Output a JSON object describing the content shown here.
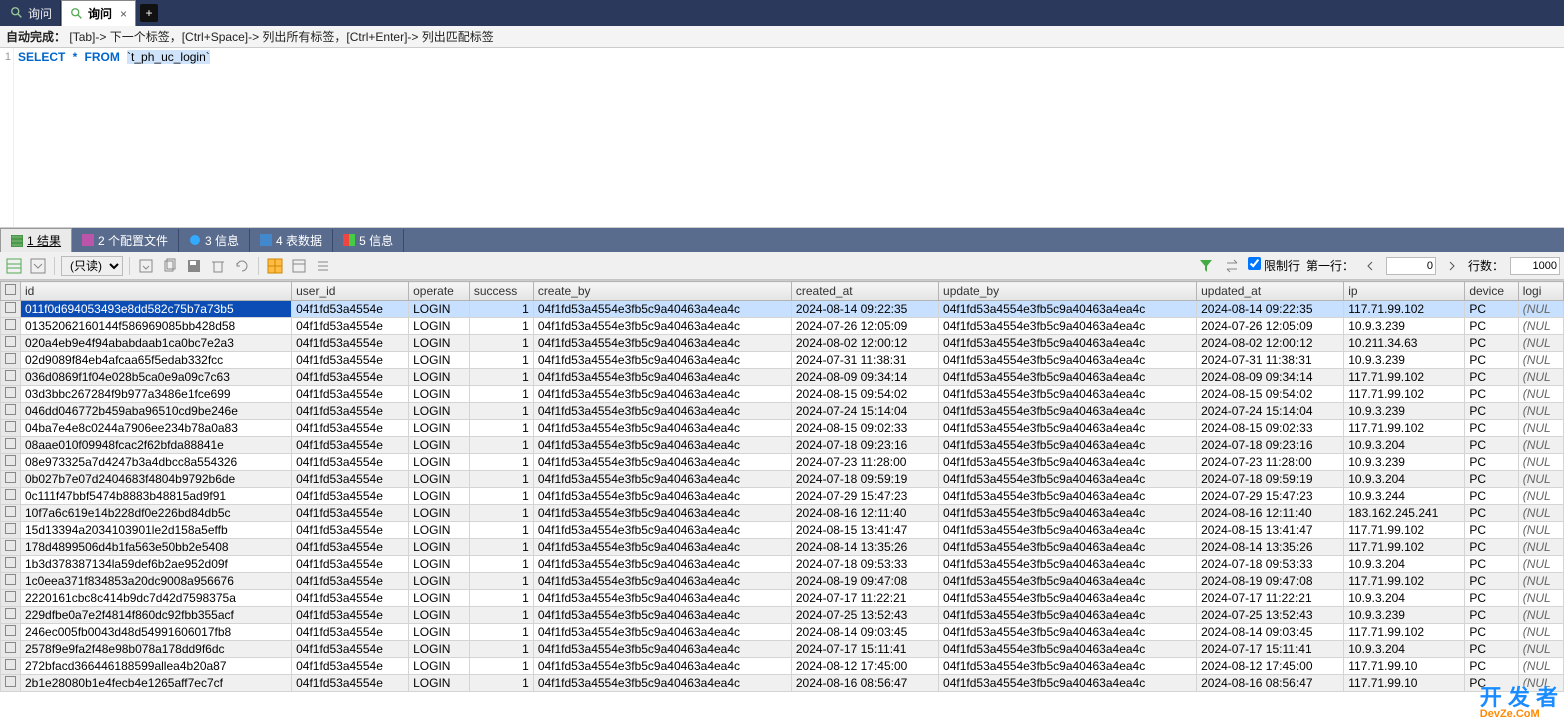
{
  "tabs": {
    "inactive": "询问",
    "active": "询问"
  },
  "hint": {
    "label": "自动完成：",
    "text": "[Tab]-> 下一个标签，[Ctrl+Space]-> 列出所有标签，[Ctrl+Enter]-> 列出匹配标签"
  },
  "editor": {
    "line": "1",
    "kw_select": "SELECT",
    "kw_star": "*",
    "kw_from": "FROM",
    "table": "`t_ph_uc_login`"
  },
  "result_tabs": {
    "t1": "1 结果",
    "t2": "2 个配置文件",
    "t3": "3 信息",
    "t4": "4 表数据",
    "t5": "5 信息"
  },
  "toolbar": {
    "readonly": "(只读)",
    "limit_label": "限制行",
    "firstrow_label": "第一行：",
    "firstrow_value": "0",
    "rows_label": "行数：",
    "rows_value": "1000"
  },
  "columns": [
    "id",
    "user_id",
    "operate",
    "success",
    "create_by",
    "created_at",
    "update_by",
    "updated_at",
    "ip",
    "device",
    "logi"
  ],
  "rows": [
    {
      "id": "011f0d694053493e8dd582c75b7a73b5",
      "created_at": "2024-08-14 09:22:35",
      "updated_at": "2024-08-14 09:22:35",
      "ip": "117.71.99.102"
    },
    {
      "id": "01352062160144f586969085bb428d58",
      "created_at": "2024-07-26 12:05:09",
      "updated_at": "2024-07-26 12:05:09",
      "ip": "10.9.3.239"
    },
    {
      "id": "020a4eb9e4f94ababdaab1ca0bc7e2a3",
      "created_at": "2024-08-02 12:00:12",
      "updated_at": "2024-08-02 12:00:12",
      "ip": "10.211.34.63"
    },
    {
      "id": "02d9089f84eb4afcaa65f5edab332fcc",
      "created_at": "2024-07-31 11:38:31",
      "updated_at": "2024-07-31 11:38:31",
      "ip": "10.9.3.239"
    },
    {
      "id": "036d0869f1f04e028b5ca0e9a09c7c63",
      "created_at": "2024-08-09 09:34:14",
      "updated_at": "2024-08-09 09:34:14",
      "ip": "117.71.99.102"
    },
    {
      "id": "03d3bbc267284f9b977a3486e1fce699",
      "created_at": "2024-08-15 09:54:02",
      "updated_at": "2024-08-15 09:54:02",
      "ip": "117.71.99.102"
    },
    {
      "id": "046dd046772b459aba96510cd9be246e",
      "created_at": "2024-07-24 15:14:04",
      "updated_at": "2024-07-24 15:14:04",
      "ip": "10.9.3.239"
    },
    {
      "id": "04ba7e4e8c0244a7906ee234b78a0a83",
      "created_at": "2024-08-15 09:02:33",
      "updated_at": "2024-08-15 09:02:33",
      "ip": "117.71.99.102"
    },
    {
      "id": "08aae010f09948fcac2f62bfda88841e",
      "created_at": "2024-07-18 09:23:16",
      "updated_at": "2024-07-18 09:23:16",
      "ip": "10.9.3.204"
    },
    {
      "id": "08e973325a7d4247b3a4dbcc8a554326",
      "created_at": "2024-07-23 11:28:00",
      "updated_at": "2024-07-23 11:28:00",
      "ip": "10.9.3.239"
    },
    {
      "id": "0b027b7e07d2404683f4804b9792b6de",
      "created_at": "2024-07-18 09:59:19",
      "updated_at": "2024-07-18 09:59:19",
      "ip": "10.9.3.204"
    },
    {
      "id": "0c111f47bbf5474b8883b48815ad9f91",
      "created_at": "2024-07-29 15:47:23",
      "updated_at": "2024-07-29 15:47:23",
      "ip": "10.9.3.244"
    },
    {
      "id": "10f7a6c619e14b228df0e226bd84db5c",
      "created_at": "2024-08-16 12:11:40",
      "updated_at": "2024-08-16 12:11:40",
      "ip": "183.162.245.241"
    },
    {
      "id": "15d13394a2034103901le2d158a5effb",
      "created_at": "2024-08-15 13:41:47",
      "updated_at": "2024-08-15 13:41:47",
      "ip": "117.71.99.102"
    },
    {
      "id": "178d4899506d4b1fa563e50bb2e5408",
      "created_at": "2024-08-14 13:35:26",
      "updated_at": "2024-08-14 13:35:26",
      "ip": "117.71.99.102"
    },
    {
      "id": "1b3d378387134la59def6b2ae952d09f",
      "created_at": "2024-07-18 09:53:33",
      "updated_at": "2024-07-18 09:53:33",
      "ip": "10.9.3.204"
    },
    {
      "id": "1c0eea371f834853a20dc9008a956676",
      "created_at": "2024-08-19 09:47:08",
      "updated_at": "2024-08-19 09:47:08",
      "ip": "117.71.99.102"
    },
    {
      "id": "2220161cbc8c414b9dc7d42d7598375a",
      "created_at": "2024-07-17 11:22:21",
      "updated_at": "2024-07-17 11:22:21",
      "ip": "10.9.3.204"
    },
    {
      "id": "229dfbe0a7e2f4814f860dc92fbb355acf",
      "created_at": "2024-07-25 13:52:43",
      "updated_at": "2024-07-25 13:52:43",
      "ip": "10.9.3.239"
    },
    {
      "id": "246ec005fb0043d48d54991606017fb8",
      "created_at": "2024-08-14 09:03:45",
      "updated_at": "2024-08-14 09:03:45",
      "ip": "117.71.99.102"
    },
    {
      "id": "2578f9e9fa2f48e98b078a178dd9f6dc",
      "created_at": "2024-07-17 15:11:41",
      "updated_at": "2024-07-17 15:11:41",
      "ip": "10.9.3.204"
    },
    {
      "id": "272bfacd366446188599allea4b20a87",
      "created_at": "2024-08-12 17:45:00",
      "updated_at": "2024-08-12 17:45:00",
      "ip": "117.71.99.10"
    },
    {
      "id": "2b1e28080b1e4fecb4e1265aff7ec7cf",
      "created_at": "2024-08-16 08:56:47",
      "updated_at": "2024-08-16 08:56:47",
      "ip": "117.71.99.10"
    }
  ],
  "common": {
    "user_id": "04f1fd53a4554e",
    "operate": "LOGIN",
    "success": "1",
    "create_by": "04f1fd53a4554e3fb5c9a40463a4ea4c",
    "update_by": "04f1fd53a4554e3fb5c9a40463a4ea4c",
    "device": "PC",
    "null": "(NUL"
  },
  "logo": {
    "main": "开 发 者",
    "sub": "DevZe.CoM"
  }
}
